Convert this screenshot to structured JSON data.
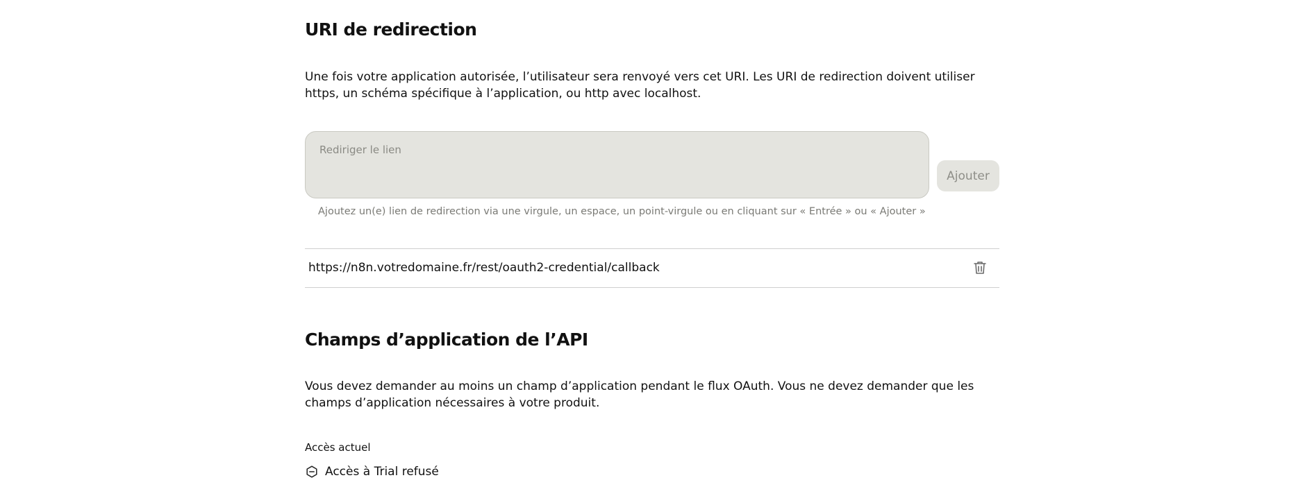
{
  "redirect_section": {
    "title": "URI de redirection",
    "description": "Une fois votre application autorisée, l’utilisateur sera renvoyé vers cet URI. Les URI de redirection doivent utiliser https, un schéma spécifique à l’application, ou http avec localhost.",
    "input_placeholder": "Rediriger le lien",
    "input_value": "",
    "add_button_label": "Ajouter",
    "hint": "Ajoutez un(e) lien de redirection via une virgule, un espace, un point-virgule ou en cliquant sur « Entrée » ou « Ajouter »",
    "uris": [
      {
        "url": "https://n8n.votredomaine.fr/rest/oauth2-credential/callback",
        "delete_icon": "trash-icon"
      }
    ]
  },
  "scopes_section": {
    "title": "Champs d’application de l’API",
    "description": "Vous devez demander au moins un champ d’application pendant le flux OAuth. Vous ne devez demander que les champs d’application nécessaires à votre produit.",
    "current_access_label": "Accès actuel",
    "current_access_value": "Accès à Trial refusé",
    "current_access_icon": "denied-icon"
  }
}
